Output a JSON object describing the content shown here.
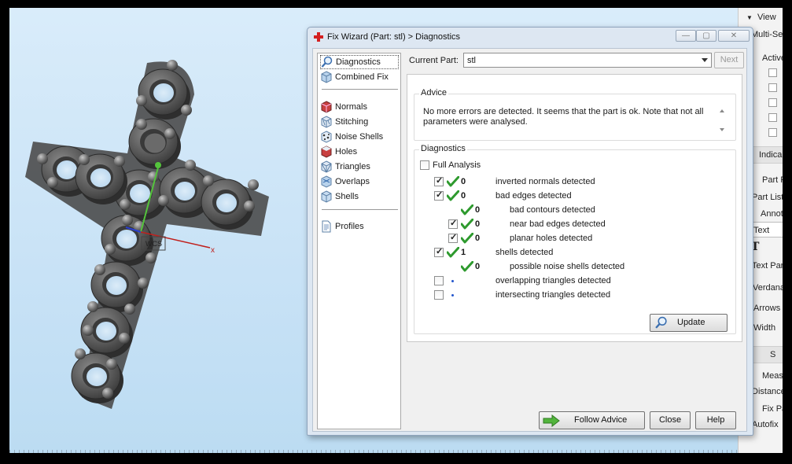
{
  "dialog": {
    "title": "Fix Wizard (Part: stl) > Diagnostics",
    "current_part_label": "Current Part:",
    "current_part_value": "stl",
    "next_label": "Next"
  },
  "nav": {
    "items": [
      {
        "label": "Diagnostics",
        "icon": "magnifier-icon",
        "selected": true
      },
      {
        "label": "Combined Fix",
        "icon": "cube-icon"
      },
      {
        "label": "Normals",
        "icon": "normals-cube-icon"
      },
      {
        "label": "Stitching",
        "icon": "stitching-cube-icon"
      },
      {
        "label": "Noise Shells",
        "icon": "noise-shells-icon"
      },
      {
        "label": "Holes",
        "icon": "holes-cube-icon"
      },
      {
        "label": "Triangles",
        "icon": "triangles-cube-icon"
      },
      {
        "label": "Overlaps",
        "icon": "overlaps-cube-icon"
      },
      {
        "label": "Shells",
        "icon": "shells-cube-icon"
      },
      {
        "label": "Profiles",
        "icon": "document-icon"
      }
    ]
  },
  "advice": {
    "label": "Advice",
    "text": "No more errors are detected. It seems that the part is ok. Note that not all parameters were analysed."
  },
  "diagnostics": {
    "label": "Diagnostics",
    "full_analysis_label": "Full Analysis",
    "rows": [
      {
        "checked": true,
        "ok": true,
        "count": "0",
        "text": "inverted normals detected"
      },
      {
        "checked": true,
        "ok": true,
        "count": "0",
        "text": "bad edges detected"
      },
      {
        "checkbox": false,
        "ok": true,
        "count": "0",
        "text": "bad contours detected"
      },
      {
        "checked": true,
        "ok": true,
        "count": "0",
        "text": "near bad edges detected"
      },
      {
        "checked": true,
        "ok": true,
        "count": "0",
        "text": "planar holes detected"
      },
      {
        "checked": true,
        "ok": true,
        "count": "1",
        "text": "shells detected"
      },
      {
        "checkbox": false,
        "ok": true,
        "count": "0",
        "text": "possible noise shells detected"
      },
      {
        "checked": false,
        "ok": false,
        "count": "",
        "text": "overlapping triangles detected"
      },
      {
        "checked": false,
        "ok": false,
        "count": "",
        "text": "intersecting triangles detected"
      }
    ],
    "update_label": "Update"
  },
  "footer": {
    "follow_advice_label": "Follow Advice",
    "close_label": "Close",
    "help_label": "Help"
  },
  "side_panel": {
    "view": "View",
    "multi_select": "Multi-Se",
    "active": "Active",
    "indicator": "Indica",
    "part_p": "Part P",
    "part_list": "Part List",
    "annot": "Annot",
    "text_tab": "Text",
    "text_glyph": "T",
    "text_params": "Text Para",
    "font": "Verdana",
    "arrows": "Arrows",
    "width": "Width",
    "s": "S",
    "measure": "Meas",
    "distance": "Distance",
    "fix_parts": "Fix Pa",
    "autofix": "Autofix"
  },
  "viewport": {
    "axis_x_label": "x",
    "wcs_label": "WCS"
  },
  "colors": {
    "accent_green": "#3aa52e",
    "check_green": "#2e9a2e",
    "dot_blue": "#2255cc",
    "dialog_frame": "#dde7f2"
  }
}
